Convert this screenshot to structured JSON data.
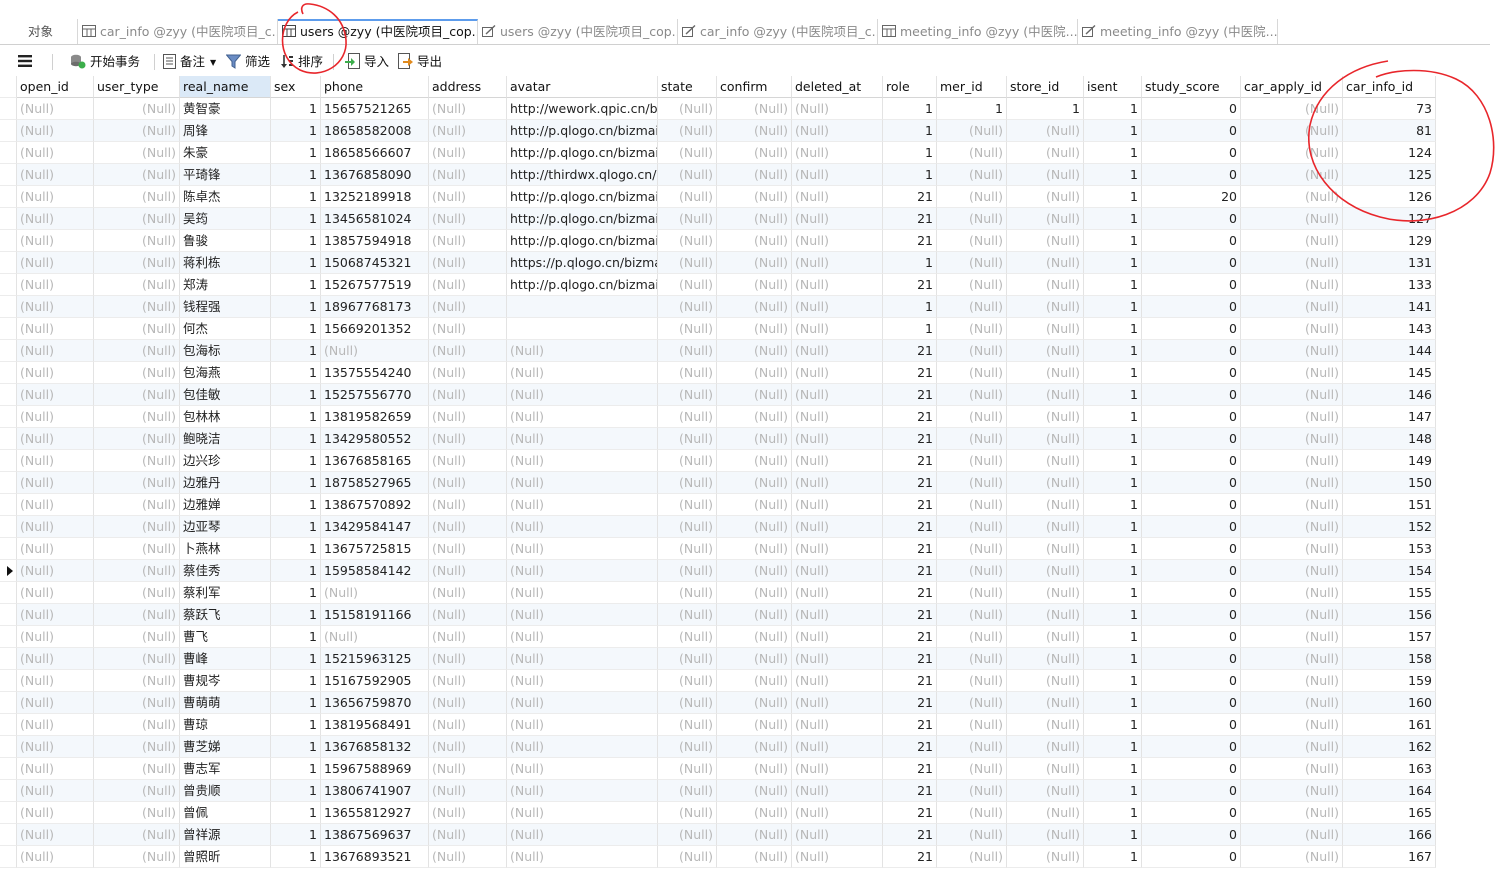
{
  "tabs": [
    {
      "label": "对象",
      "icon": "none"
    },
    {
      "label": "car_info @zyy (中医院项目_c...",
      "icon": "table-icon"
    },
    {
      "label": "users @zyy (中医院项目_cop...",
      "icon": "table-icon",
      "active": true
    },
    {
      "label": "users @zyy (中医院项目_cop...",
      "icon": "design-icon"
    },
    {
      "label": "car_info @zyy (中医院项目_c...",
      "icon": "design-icon"
    },
    {
      "label": "meeting_info @zyy (中医院...",
      "icon": "table-icon"
    },
    {
      "label": "meeting_info @zyy (中医院...",
      "icon": "design-icon"
    }
  ],
  "toolbar": {
    "begin_tx": "开始事务",
    "note": "备注",
    "filter": "筛选",
    "sort": "排序",
    "import": "导入",
    "export": "导出"
  },
  "null_text": "(Null)",
  "columns": [
    "open_id",
    "user_type",
    "real_name",
    "sex",
    "phone",
    "address",
    "avatar",
    "state",
    "confirm",
    "deleted_at",
    "role",
    "mer_id",
    "store_id",
    "isent",
    "study_score",
    "car_apply_id",
    "car_info_id"
  ],
  "rows": [
    {
      "real_name": "黄智豪",
      "sex": "1",
      "phone": "15657521265",
      "avatar": "http://wework.qpic.cn/biz",
      "role": "1",
      "mer_id": "1",
      "store_id": "1",
      "isent": "1",
      "study_score": "0",
      "car_info_id": "73"
    },
    {
      "real_name": "周锋",
      "sex": "1",
      "phone": "18658582008",
      "avatar": "http://p.qlogo.cn/bizmail/",
      "role": "1",
      "isent": "1",
      "study_score": "0",
      "car_info_id": "81"
    },
    {
      "real_name": "朱豪",
      "sex": "1",
      "phone": "18658566607",
      "avatar": "http://p.qlogo.cn/bizmail/",
      "role": "1",
      "isent": "1",
      "study_score": "0",
      "car_info_id": "124"
    },
    {
      "real_name": "平琦锋",
      "sex": "1",
      "phone": "13676858090",
      "avatar": "http://thirdwx.qlogo.cn/m",
      "role": "1",
      "isent": "1",
      "study_score": "0",
      "car_info_id": "125"
    },
    {
      "real_name": "陈卓杰",
      "sex": "1",
      "phone": "13252189918",
      "avatar": "http://p.qlogo.cn/bizmail/",
      "role": "21",
      "isent": "1",
      "study_score": "20",
      "car_info_id": "126"
    },
    {
      "real_name": "吴筠",
      "sex": "1",
      "phone": "13456581024",
      "avatar": "http://p.qlogo.cn/bizmail/",
      "role": "21",
      "isent": "1",
      "study_score": "0",
      "car_info_id": "127"
    },
    {
      "real_name": "鲁骏",
      "sex": "1",
      "phone": "13857594918",
      "avatar": "http://p.qlogo.cn/bizmail/",
      "role": "21",
      "isent": "1",
      "study_score": "0",
      "car_info_id": "129"
    },
    {
      "real_name": "蒋利栋",
      "sex": "1",
      "phone": "15068745321",
      "avatar": "https://p.qlogo.cn/bizmai",
      "role": "1",
      "isent": "1",
      "study_score": "0",
      "car_info_id": "131"
    },
    {
      "real_name": "郑涛",
      "sex": "1",
      "phone": "15267577519",
      "avatar": "http://p.qlogo.cn/bizmail/",
      "role": "21",
      "isent": "1",
      "study_score": "0",
      "car_info_id": "133"
    },
    {
      "real_name": "钱程强",
      "sex": "1",
      "phone": "18967768173",
      "avatar": "",
      "role": "1",
      "isent": "1",
      "study_score": "0",
      "car_info_id": "141"
    },
    {
      "real_name": "何杰",
      "sex": "1",
      "phone": "15669201352",
      "avatar": "",
      "role": "1",
      "isent": "1",
      "study_score": "0",
      "car_info_id": "143"
    },
    {
      "real_name": "包海标",
      "sex": "1",
      "phone": null,
      "role": "21",
      "isent": "1",
      "study_score": "0",
      "car_info_id": "144"
    },
    {
      "real_name": "包海燕",
      "sex": "1",
      "phone": "13575554240",
      "role": "21",
      "isent": "1",
      "study_score": "0",
      "car_info_id": "145"
    },
    {
      "real_name": "包佳敏",
      "sex": "1",
      "phone": "15257556770",
      "role": "21",
      "isent": "1",
      "study_score": "0",
      "car_info_id": "146"
    },
    {
      "real_name": "包林林",
      "sex": "1",
      "phone": "13819582659",
      "role": "21",
      "isent": "1",
      "study_score": "0",
      "car_info_id": "147"
    },
    {
      "real_name": "鲍晓洁",
      "sex": "1",
      "phone": "13429580552",
      "role": "21",
      "isent": "1",
      "study_score": "0",
      "car_info_id": "148"
    },
    {
      "real_name": "边兴珍",
      "sex": "1",
      "phone": "13676858165",
      "role": "21",
      "isent": "1",
      "study_score": "0",
      "car_info_id": "149"
    },
    {
      "real_name": "边雅丹",
      "sex": "1",
      "phone": "18758527965",
      "role": "21",
      "isent": "1",
      "study_score": "0",
      "car_info_id": "150"
    },
    {
      "real_name": "边雅婵",
      "sex": "1",
      "phone": "13867570892",
      "role": "21",
      "isent": "1",
      "study_score": "0",
      "car_info_id": "151"
    },
    {
      "real_name": "边亚琴",
      "sex": "1",
      "phone": "13429584147",
      "role": "21",
      "isent": "1",
      "study_score": "0",
      "car_info_id": "152"
    },
    {
      "real_name": "卜燕林",
      "sex": "1",
      "phone": "13675725815",
      "role": "21",
      "isent": "1",
      "study_score": "0",
      "car_info_id": "153"
    },
    {
      "real_name": "蔡佳秀",
      "sex": "1",
      "phone": "15958584142",
      "role": "21",
      "isent": "1",
      "study_score": "0",
      "car_info_id": "154",
      "current": true
    },
    {
      "real_name": "蔡利军",
      "sex": "1",
      "phone": null,
      "role": "21",
      "isent": "1",
      "study_score": "0",
      "car_info_id": "155"
    },
    {
      "real_name": "蔡跃飞",
      "sex": "1",
      "phone": "15158191166",
      "role": "21",
      "isent": "1",
      "study_score": "0",
      "car_info_id": "156"
    },
    {
      "real_name": "曹飞",
      "sex": "1",
      "phone": null,
      "role": "21",
      "isent": "1",
      "study_score": "0",
      "car_info_id": "157"
    },
    {
      "real_name": "曹峰",
      "sex": "1",
      "phone": "15215963125",
      "role": "21",
      "isent": "1",
      "study_score": "0",
      "car_info_id": "158"
    },
    {
      "real_name": "曹规岑",
      "sex": "1",
      "phone": "15167592905",
      "role": "21",
      "isent": "1",
      "study_score": "0",
      "car_info_id": "159"
    },
    {
      "real_name": "曹萌萌",
      "sex": "1",
      "phone": "13656759870",
      "role": "21",
      "isent": "1",
      "study_score": "0",
      "car_info_id": "160"
    },
    {
      "real_name": "曹琼",
      "sex": "1",
      "phone": "13819568491",
      "role": "21",
      "isent": "1",
      "study_score": "0",
      "car_info_id": "161"
    },
    {
      "real_name": "曹芝娣",
      "sex": "1",
      "phone": "13676858132",
      "role": "21",
      "isent": "1",
      "study_score": "0",
      "car_info_id": "162"
    },
    {
      "real_name": "曹志军",
      "sex": "1",
      "phone": "15967588969",
      "role": "21",
      "isent": "1",
      "study_score": "0",
      "car_info_id": "163"
    },
    {
      "real_name": "曾贵顺",
      "sex": "1",
      "phone": "13806741907",
      "role": "21",
      "isent": "1",
      "study_score": "0",
      "car_info_id": "164"
    },
    {
      "real_name": "曾佩",
      "sex": "1",
      "phone": "13655812927",
      "role": "21",
      "isent": "1",
      "study_score": "0",
      "car_info_id": "165"
    },
    {
      "real_name": "曾祥源",
      "sex": "1",
      "phone": "13867569637",
      "role": "21",
      "isent": "1",
      "study_score": "0",
      "car_info_id": "166"
    },
    {
      "real_name": "曾照昕",
      "sex": "1",
      "phone": "13676893521",
      "role": "21",
      "isent": "1",
      "study_score": "0",
      "car_info_id": "167"
    }
  ],
  "colors": {
    "null_text": "#b8b8b8",
    "selected_header": "#dbe9f7",
    "annotation": "#e8262b",
    "active_tab": "#5d9cec"
  }
}
